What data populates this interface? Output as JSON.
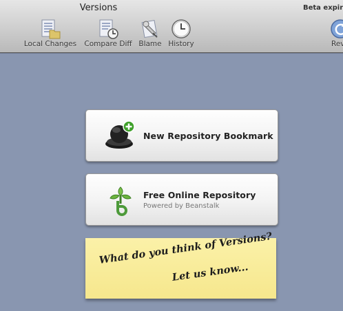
{
  "window": {
    "title": "Versions",
    "beta_notice": "Beta expire"
  },
  "toolbar": {
    "items": [
      {
        "label": "Local Changes",
        "icon": "local-changes-icon"
      },
      {
        "label": "Compare Diff",
        "icon": "compare-diff-icon"
      },
      {
        "label": "Blame",
        "icon": "blame-icon"
      },
      {
        "label": "History",
        "icon": "history-icon"
      },
      {
        "label": "Reve",
        "icon": "revert-icon"
      }
    ]
  },
  "main": {
    "bookmark_button": {
      "title": "New Repository Bookmark",
      "icon": "repository-bookmark-icon"
    },
    "online_button": {
      "title": "Free Online Repository",
      "subtitle": "Powered by Beanstalk",
      "icon": "beanstalk-icon"
    },
    "feedback_note": {
      "line1": "What do you think of Versions?",
      "line2": "Let us know..."
    }
  },
  "colors": {
    "background": "#8996b0",
    "note": "#f6e78d",
    "plus_badge": "#3fa02a",
    "beanstalk": "#4d9a3a"
  }
}
